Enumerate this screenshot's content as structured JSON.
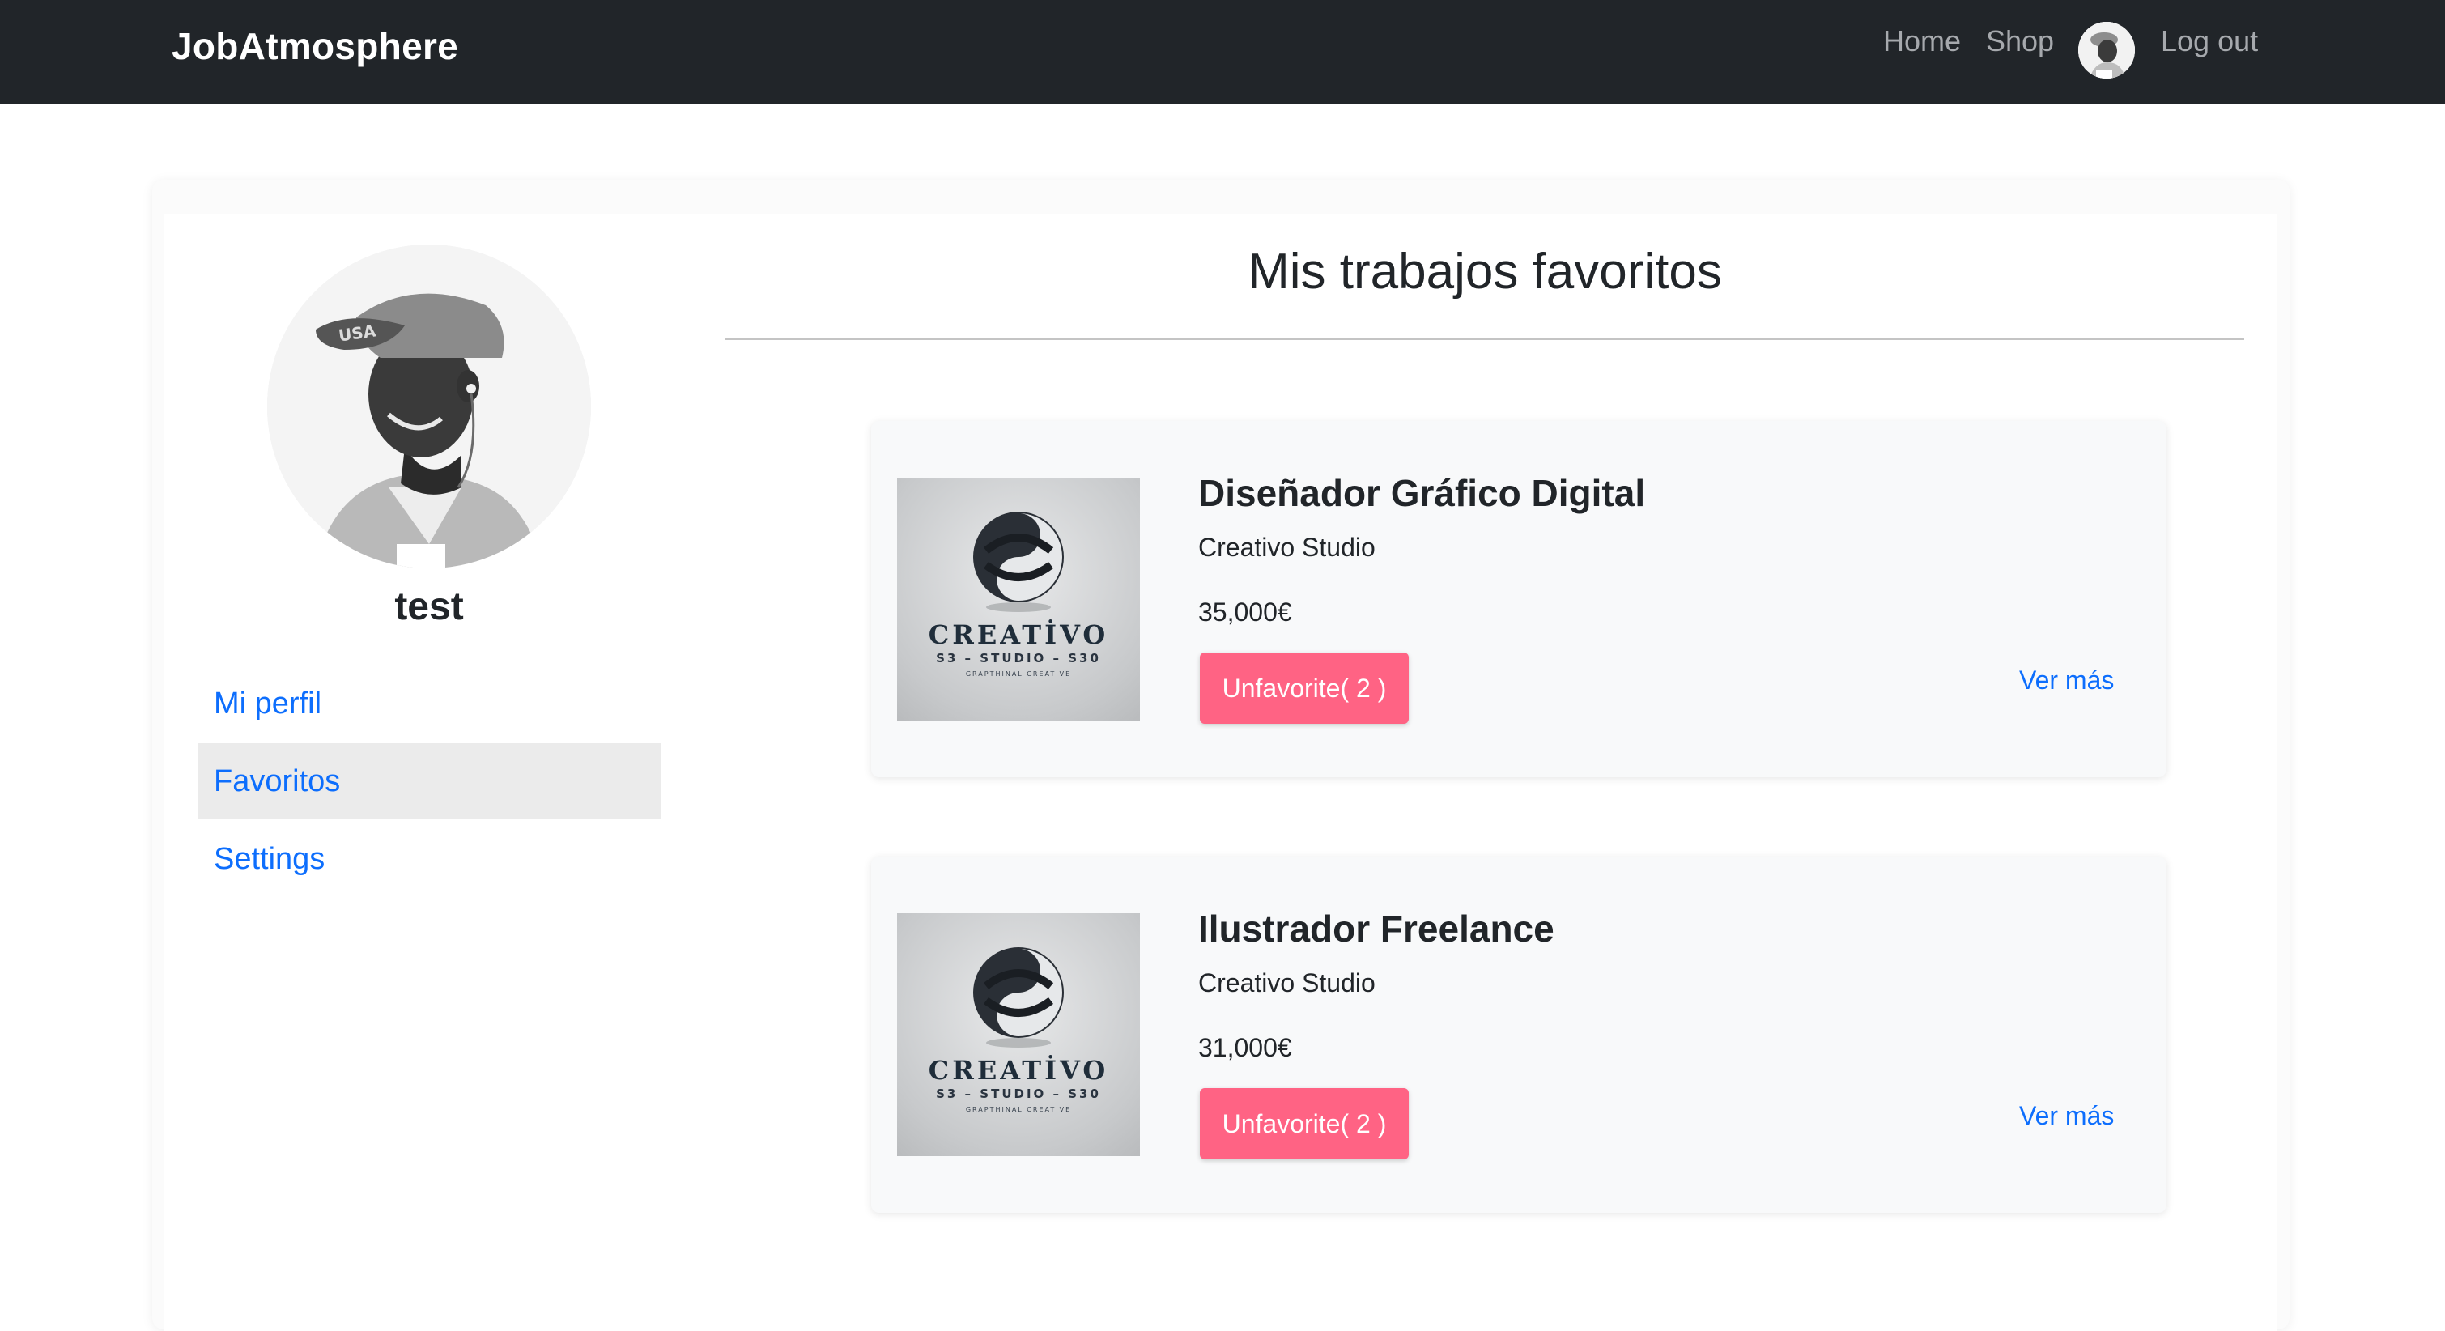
{
  "navbar": {
    "brand": "JobAtmosphere",
    "links": {
      "home": "Home",
      "shop": "Shop",
      "logout": "Log out"
    },
    "avatar_icon": "user-avatar-icon"
  },
  "sidebar": {
    "username": "test",
    "items": [
      {
        "label": "Mi perfil",
        "active": false
      },
      {
        "label": "Favoritos",
        "active": true
      },
      {
        "label": "Settings",
        "active": false
      }
    ]
  },
  "main": {
    "title": "Mis trabajos favoritos",
    "jobs": [
      {
        "title": "Diseñador Gráfico Digital",
        "company": "Creativo Studio",
        "salary": "35,000€",
        "unfavorite_label": "Unfavorite( 2 )",
        "more_label": "Ver más",
        "logo": {
          "word": "CREATİVO",
          "sub": "S3 – STUDIO – S30",
          "tag": "GRAPTHINAL CREATIVE"
        }
      },
      {
        "title": "Ilustrador Freelance",
        "company": "Creativo Studio",
        "salary": "31,000€",
        "unfavorite_label": "Unfavorite( 2 )",
        "more_label": "Ver más",
        "logo": {
          "word": "CREATİVO",
          "sub": "S3 – STUDIO – S30",
          "tag": "GRAPTHINAL CREATIVE"
        }
      }
    ]
  },
  "colors": {
    "navbar_bg": "#212529",
    "link_blue": "#0d6efd",
    "unfavorite_pink": "#ff6384",
    "card_bg": "#f8f9fa",
    "active_item_bg": "#ebebeb"
  }
}
